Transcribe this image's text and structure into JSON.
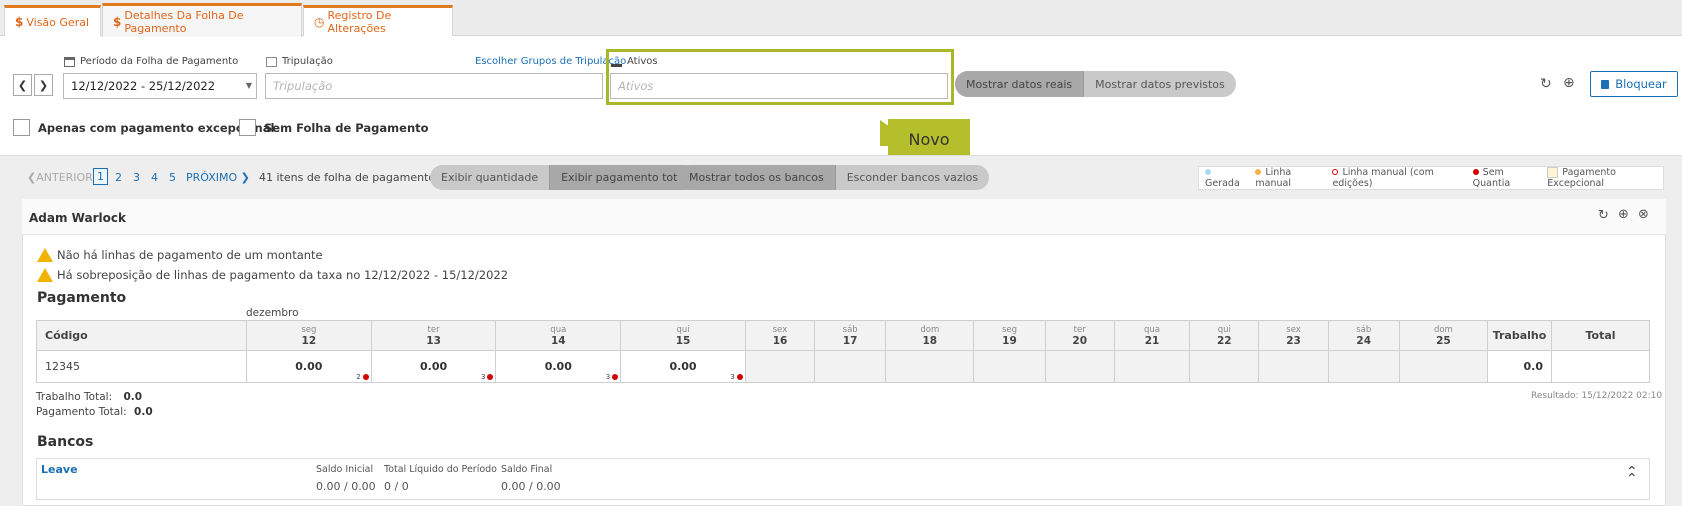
{
  "tabs": [
    {
      "icon": "$",
      "label": "Visão Geral"
    },
    {
      "icon": "$",
      "label": "Detalhes Da Folha De Pagamento"
    },
    {
      "icon": "◷",
      "label": "Registro De Alterações"
    }
  ],
  "filters": {
    "period_label": "Período da Folha de Pagamento",
    "period_value": "12/12/2022 - 25/12/2022",
    "crew_label": "Tripulação",
    "crew_placeholder": "Tripulação",
    "crew_groups_link": "Escolher Grupos de Tripulação",
    "assets_label": "Ativos",
    "assets_placeholder": "Ativos",
    "show_real": "Mostrar datos reais",
    "show_forecast": "Mostrar datos previstos",
    "lock_label": "Bloquear",
    "only_exceptional": "Apenas com pagamento excepcional",
    "no_payroll": "Sem Folha de Pagamento"
  },
  "callout": {
    "text": "Novo"
  },
  "pager": {
    "prev": "ANTERIOR",
    "pages": [
      "1",
      "2",
      "3",
      "4",
      "5"
    ],
    "next": "PRÓXIMO",
    "count_text": "41 itens de folha de pagamento",
    "show_qty": "Exibir quantidade",
    "show_total": "Exibir pagamento total",
    "show_all_banks": "Mostrar todos os bancos",
    "hide_empty_banks": "Esconder bancos vazios"
  },
  "legend": [
    {
      "label": "Gerada",
      "color": "#a9d8ef"
    },
    {
      "label": "Linha manual",
      "color": "#f5b24a"
    },
    {
      "label": "Linha manual (com edições)",
      "color": "#d40000"
    },
    {
      "label": "Sem Quantia",
      "color": "#d40000"
    },
    {
      "label": "Pagamento Excepcional",
      "color": "#fff4d6"
    }
  ],
  "employee": {
    "name": "Adam Warlock",
    "warnings": [
      "Não há linhas de pagamento de um montante",
      "Há sobreposição de linhas de pagamento da taxa no 12/12/2022 - 15/12/2022"
    ],
    "payment_title": "Pagamento",
    "month": "dezembro",
    "col_code": "Código",
    "col_work": "Trabalho",
    "col_total": "Total",
    "days": [
      {
        "dow": "seg",
        "num": "12"
      },
      {
        "dow": "ter",
        "num": "13"
      },
      {
        "dow": "qua",
        "num": "14"
      },
      {
        "dow": "qui",
        "num": "15"
      },
      {
        "dow": "sex",
        "num": "16"
      },
      {
        "dow": "sáb",
        "num": "17"
      },
      {
        "dow": "dom",
        "num": "18"
      },
      {
        "dow": "seg",
        "num": "19"
      },
      {
        "dow": "ter",
        "num": "20"
      },
      {
        "dow": "qua",
        "num": "21"
      },
      {
        "dow": "qui",
        "num": "22"
      },
      {
        "dow": "sex",
        "num": "23"
      },
      {
        "dow": "sáb",
        "num": "24"
      },
      {
        "dow": "dom",
        "num": "25"
      }
    ],
    "row": {
      "code": "12345",
      "values": [
        "0.00",
        "0.00",
        "0.00",
        "0.00"
      ],
      "counts": [
        "2",
        "3",
        "3",
        "3"
      ],
      "work": "0.0",
      "total": ""
    },
    "work_total_label": "Trabalho Total:",
    "work_total_value": "0.0",
    "pay_total_label": "Pagamento Total:",
    "pay_total_value": "0.0",
    "result": "Resultado: 15/12/2022 02:10",
    "banks_title": "Bancos",
    "bank": {
      "name": "Leave",
      "initial_label": "Saldo Inicial",
      "initial_value": "0.00 / 0.00",
      "net_label": "Total Líquido do Período",
      "net_value": "0 / 0",
      "final_label": "Saldo Final",
      "final_value": "0.00 / 0.00"
    }
  }
}
